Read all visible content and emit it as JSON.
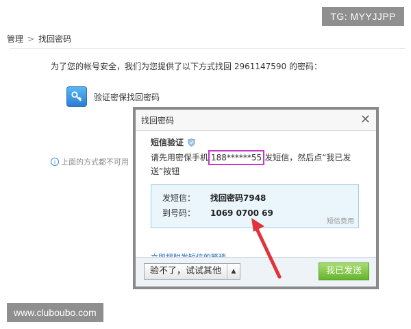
{
  "watermarks": {
    "top_right": "TG: MYYJJPP",
    "bottom_left": "www.cluboubo.com"
  },
  "breadcrumb": {
    "parent": "管理",
    "separator": ">",
    "current": "找回密码"
  },
  "intro_text": "为了您的帐号安全，我们为您提供了以下方式找回 2961147590 的密码：",
  "option": {
    "label": "验证密保找回密码",
    "icon": "key-icon"
  },
  "note_text": "上面的方式都不可用",
  "dialog": {
    "title": "找回密码",
    "close_label": "✕",
    "sms_title": "短信验证",
    "instruction_pre": "请先用密保手机",
    "phone": "188******55",
    "instruction_post": "发短信，然后点“我已发送”按钮",
    "send_label": "发短信：",
    "send_value": "找回密码7948",
    "to_label": "到号码：",
    "to_value": "1069 0700 69",
    "fee_link": "短信费用",
    "help_link": "立即摆脱发短信的繁琐",
    "other_button": "验不了，试试其他",
    "other_arrow": "▲",
    "sent_button": "我已发送"
  },
  "colors": {
    "highlight_border": "#c43ac6",
    "arrow": "#e0343a",
    "primary_button": "#66b32e"
  }
}
